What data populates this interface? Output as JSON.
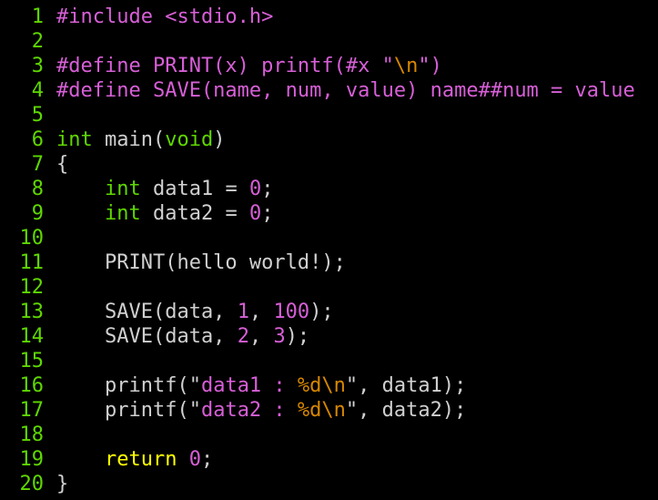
{
  "editor": {
    "colors": {
      "background": "#000000",
      "line_number": "#5fd700",
      "plain": "#d0d0d0",
      "preprocessor": "#d75fd7",
      "type": "#5fd700",
      "number": "#d75fd7",
      "string": "#d75fd7",
      "escape": "#d78700",
      "keyword": "#ffff00"
    },
    "lines": [
      {
        "n": "1",
        "tokens": [
          {
            "t": "#include <stdio.h>",
            "c": "pre"
          }
        ]
      },
      {
        "n": "2",
        "tokens": []
      },
      {
        "n": "3",
        "tokens": [
          {
            "t": "#define PRINT(x) printf(#x \"",
            "c": "pre"
          },
          {
            "t": "\\n",
            "c": "esc"
          },
          {
            "t": "\")",
            "c": "pre"
          }
        ]
      },
      {
        "n": "4",
        "tokens": [
          {
            "t": "#define SAVE(name, num, value) name##num = value",
            "c": "pre"
          }
        ]
      },
      {
        "n": "5",
        "tokens": []
      },
      {
        "n": "6",
        "tokens": [
          {
            "t": "int",
            "c": "type"
          },
          {
            "t": " main(",
            "c": "plain"
          },
          {
            "t": "void",
            "c": "type"
          },
          {
            "t": ")",
            "c": "plain"
          }
        ]
      },
      {
        "n": "7",
        "tokens": [
          {
            "t": "{",
            "c": "plain"
          }
        ]
      },
      {
        "n": "8",
        "tokens": [
          {
            "t": "    ",
            "c": "plain"
          },
          {
            "t": "int",
            "c": "type"
          },
          {
            "t": " data1 = ",
            "c": "plain"
          },
          {
            "t": "0",
            "c": "num"
          },
          {
            "t": ";",
            "c": "plain"
          }
        ]
      },
      {
        "n": "9",
        "tokens": [
          {
            "t": "    ",
            "c": "plain"
          },
          {
            "t": "int",
            "c": "type"
          },
          {
            "t": " data2 = ",
            "c": "plain"
          },
          {
            "t": "0",
            "c": "num"
          },
          {
            "t": ";",
            "c": "plain"
          }
        ]
      },
      {
        "n": "10",
        "tokens": []
      },
      {
        "n": "11",
        "tokens": [
          {
            "t": "    PRINT(hello world!);",
            "c": "plain"
          }
        ]
      },
      {
        "n": "12",
        "tokens": []
      },
      {
        "n": "13",
        "tokens": [
          {
            "t": "    SAVE(data, ",
            "c": "plain"
          },
          {
            "t": "1",
            "c": "num"
          },
          {
            "t": ", ",
            "c": "plain"
          },
          {
            "t": "100",
            "c": "num"
          },
          {
            "t": ");",
            "c": "plain"
          }
        ]
      },
      {
        "n": "14",
        "tokens": [
          {
            "t": "    SAVE(data, ",
            "c": "plain"
          },
          {
            "t": "2",
            "c": "num"
          },
          {
            "t": ", ",
            "c": "plain"
          },
          {
            "t": "3",
            "c": "num"
          },
          {
            "t": ");",
            "c": "plain"
          }
        ]
      },
      {
        "n": "15",
        "tokens": []
      },
      {
        "n": "16",
        "tokens": [
          {
            "t": "    printf(\"",
            "c": "plain"
          },
          {
            "t": "data1 : ",
            "c": "str"
          },
          {
            "t": "%d\\n",
            "c": "esc"
          },
          {
            "t": "\", data1);",
            "c": "plain"
          }
        ]
      },
      {
        "n": "17",
        "tokens": [
          {
            "t": "    printf(\"",
            "c": "plain"
          },
          {
            "t": "data2 : ",
            "c": "str"
          },
          {
            "t": "%d\\n",
            "c": "esc"
          },
          {
            "t": "\", data2);",
            "c": "plain"
          }
        ]
      },
      {
        "n": "18",
        "tokens": []
      },
      {
        "n": "19",
        "tokens": [
          {
            "t": "    ",
            "c": "plain"
          },
          {
            "t": "return",
            "c": "kw"
          },
          {
            "t": " ",
            "c": "plain"
          },
          {
            "t": "0",
            "c": "num"
          },
          {
            "t": ";",
            "c": "plain"
          }
        ]
      },
      {
        "n": "20",
        "tokens": [
          {
            "t": "}",
            "c": "plain"
          }
        ]
      }
    ]
  }
}
